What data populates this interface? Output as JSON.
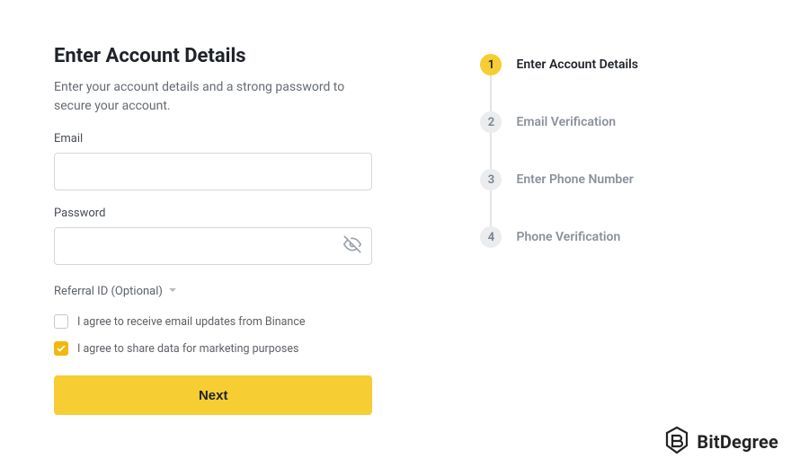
{
  "header": {
    "title": "Enter Account Details",
    "subtitle": "Enter your account details and a strong password to secure your account."
  },
  "form": {
    "email_label": "Email",
    "email_value": "",
    "password_label": "Password",
    "password_value": "",
    "referral_label": "Referral ID (Optional)",
    "checkbox_updates_label": "I agree to receive email updates from Binance",
    "checkbox_updates_checked": false,
    "checkbox_marketing_label": "I agree to share data for marketing purposes",
    "checkbox_marketing_checked": true,
    "next_button_label": "Next"
  },
  "steps": [
    {
      "num": "1",
      "label": "Enter Account Details",
      "active": true
    },
    {
      "num": "2",
      "label": "Email Verification",
      "active": false
    },
    {
      "num": "3",
      "label": "Enter Phone Number",
      "active": false
    },
    {
      "num": "4",
      "label": "Phone Verification",
      "active": false
    }
  ],
  "watermark": {
    "brand": "BitDegree"
  },
  "colors": {
    "accent": "#f6cd32",
    "text_primary": "#1e2329",
    "text_muted": "#8b919a"
  }
}
